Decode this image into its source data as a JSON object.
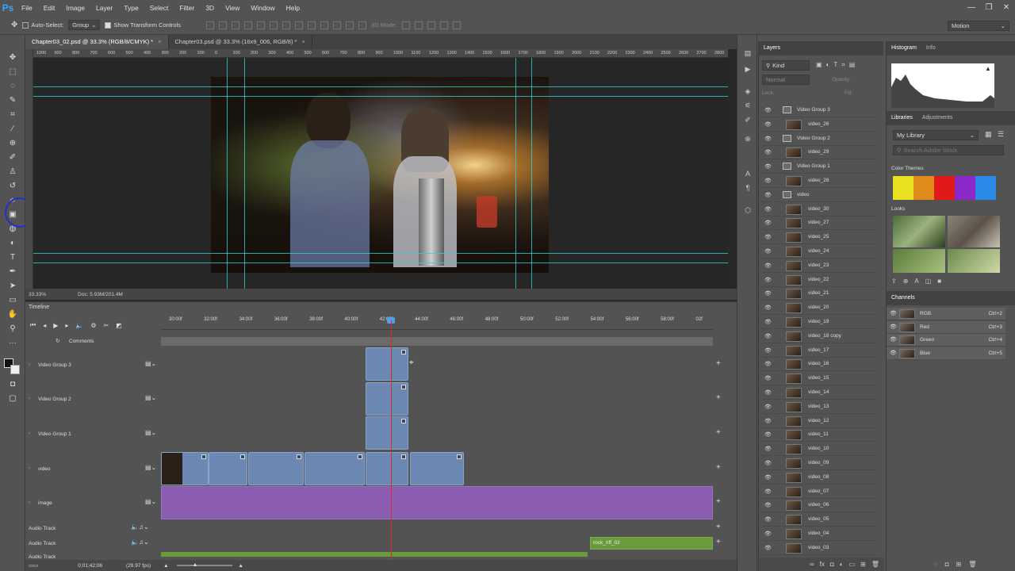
{
  "app": {
    "logo": "Ps",
    "menu": [
      "File",
      "Edit",
      "Image",
      "Layer",
      "Type",
      "Select",
      "Filter",
      "3D",
      "View",
      "Window",
      "Help"
    ],
    "win_controls": [
      "—",
      "❐",
      "✕"
    ]
  },
  "options": {
    "auto_select": "Auto-Select:",
    "auto_select_value": "Group",
    "show_transform": "Show Transform Controls",
    "mode_3d": "3D Mode:",
    "workspace": "Motion"
  },
  "tabs": [
    {
      "label": "Chapter03_02.psd @ 33.3% (RGB/8/CMYK) *"
    },
    {
      "label": "Chapter03.psd @ 33.3% (16x9_006, RGB/8) *"
    }
  ],
  "ruler_ticks": [
    "1000",
    "900",
    "800",
    "700",
    "600",
    "500",
    "400",
    "300",
    "200",
    "100",
    "0",
    "100",
    "200",
    "300",
    "400",
    "500",
    "600",
    "700",
    "800",
    "900",
    "1000",
    "1100",
    "1200",
    "1300",
    "1400",
    "1500",
    "1600",
    "1700",
    "1800",
    "1900",
    "2000",
    "2100",
    "2200",
    "2300",
    "2400",
    "2500",
    "2600",
    "2700",
    "2800"
  ],
  "status": {
    "zoom": "33.33%",
    "doc": "Doc: 5.93M/201.4M"
  },
  "timeline": {
    "title": "Timeline",
    "ticks": [
      "30:00f",
      "32:00f",
      "34:00f",
      "36:00f",
      "38:00f",
      "40:00f",
      "42:00f",
      "44:00f",
      "46:00f",
      "48:00f",
      "50:00f",
      "52:00f",
      "54:00f",
      "56:00f",
      "58:00f",
      "02f"
    ],
    "comments": "Comments",
    "tracks": [
      "Video Group 3",
      "Video Group 2",
      "Video Group 1",
      "video",
      "image",
      "Audio Track",
      "Audio Track",
      "Audio Track"
    ],
    "audio_clip": "rock_riff_02",
    "timecode": "0;01;42;06",
    "fps": "(29.97 fps)"
  },
  "layers": {
    "title": "Layers",
    "kind": "Kind",
    "blend": "Normal",
    "opacity": "Opacity:",
    "lock": "Lock:",
    "fill": "Fill:",
    "rows": [
      {
        "name": "Video Group 3",
        "group": true
      },
      {
        "name": "video_26",
        "group": false
      },
      {
        "name": "Video Group 2",
        "group": true
      },
      {
        "name": "video_29",
        "group": false
      },
      {
        "name": "Video Group 1",
        "group": true
      },
      {
        "name": "video_28",
        "group": false
      },
      {
        "name": "video",
        "group": true
      },
      {
        "name": "video_30",
        "group": false
      },
      {
        "name": "video_27",
        "group": false
      },
      {
        "name": "video_25",
        "group": false
      },
      {
        "name": "video_24",
        "group": false
      },
      {
        "name": "video_23",
        "group": false
      },
      {
        "name": "video_22",
        "group": false
      },
      {
        "name": "video_21",
        "group": false
      },
      {
        "name": "video_20",
        "group": false
      },
      {
        "name": "video_19",
        "group": false
      },
      {
        "name": "video_18 copy",
        "group": false
      },
      {
        "name": "video_17",
        "group": false
      },
      {
        "name": "video_16",
        "group": false
      },
      {
        "name": "video_15",
        "group": false
      },
      {
        "name": "video_14",
        "group": false
      },
      {
        "name": "video_13",
        "group": false
      },
      {
        "name": "video_12",
        "group": false
      },
      {
        "name": "video_11",
        "group": false
      },
      {
        "name": "video_10",
        "group": false
      },
      {
        "name": "video_09",
        "group": false
      },
      {
        "name": "video_08",
        "group": false
      },
      {
        "name": "video_07",
        "group": false
      },
      {
        "name": "video_06",
        "group": false
      },
      {
        "name": "video_05",
        "group": false
      },
      {
        "name": "video_04",
        "group": false
      },
      {
        "name": "video_03",
        "group": false
      }
    ]
  },
  "histogram": {
    "tab1": "Histogram",
    "tab2": "Info"
  },
  "libraries": {
    "tab1": "Libraries",
    "tab2": "Adjustments",
    "library": "My Library",
    "search": "Search Adobe Stock",
    "color_themes": "Color Themes",
    "looks": "Looks",
    "swatches": [
      "#e8e020",
      "#e08a1a",
      "#e01a1a",
      "#8a28c8",
      "#2a8ae8"
    ]
  },
  "channels": {
    "title": "Channels",
    "rows": [
      {
        "name": "RGB",
        "sc": "Ctrl+2"
      },
      {
        "name": "Red",
        "sc": "Ctrl+3"
      },
      {
        "name": "Green",
        "sc": "Ctrl+4"
      },
      {
        "name": "Blue",
        "sc": "Ctrl+5"
      }
    ]
  }
}
